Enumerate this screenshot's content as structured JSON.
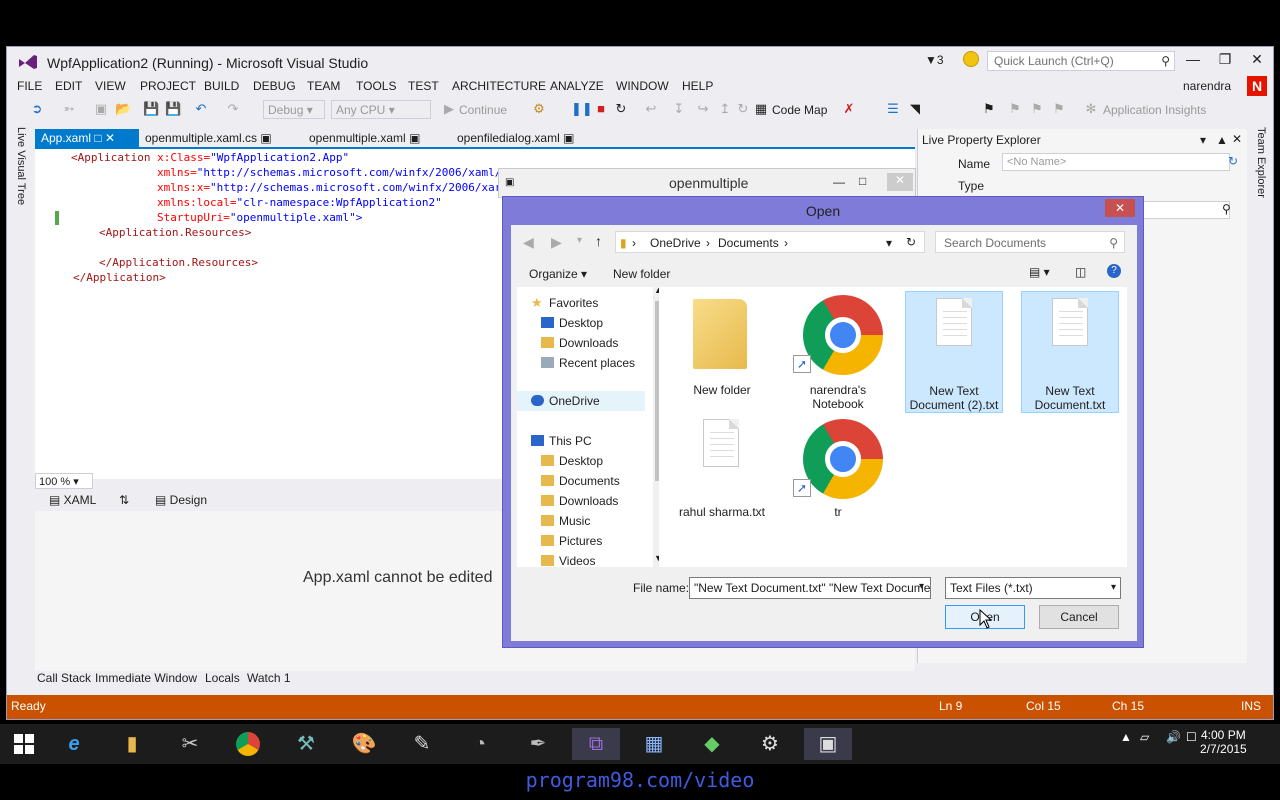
{
  "vs": {
    "title": "WpfApplication2 (Running) - Microsoft Visual Studio",
    "notification_count": "3",
    "quick_launch_placeholder": "Quick Launch (Ctrl+Q)",
    "user": "narendra",
    "user_badge": "N",
    "menu": [
      "FILE",
      "EDIT",
      "VIEW",
      "PROJECT",
      "BUILD",
      "DEBUG",
      "TEAM",
      "TOOLS",
      "TEST",
      "ARCHITECTURE",
      "ANALYZE",
      "WINDOW",
      "HELP"
    ],
    "toolbar": {
      "config": "Debug",
      "platform": "Any CPU",
      "continue": "Continue",
      "code_map": "Code Map",
      "app_insights": "Application Insights"
    },
    "left_vertical_tab": "Live Visual Tree",
    "right_vertical_tab": "Team Explorer"
  },
  "doc_tabs": [
    {
      "label": "App.xaml"
    },
    {
      "label": "openmultiple.xaml.cs"
    },
    {
      "label": "openmultiple.xaml"
    },
    {
      "label": "openfiledialog.xaml"
    }
  ],
  "code": {
    "l1_tag": "<Application",
    "l1_attr": " x:Class=",
    "l1_val": "\"WpfApplication2.App\"",
    "l2_attr": "xmlns=",
    "l2_val": "\"http://schemas.microsoft.com/winfx/2006/xaml/",
    "l3_attr": "xmlns:x=",
    "l3_val": "\"http://schemas.microsoft.com/winfx/2006/xar",
    "l4_attr": "xmlns:local=",
    "l4_val": "\"clr-namespace:WpfApplication2\"",
    "l5_attr": "StartupUri=",
    "l5_val": "\"openmultiple.xaml\"",
    "l5_end": ">",
    "l6": "<Application.Resources>",
    "l7": "</Application.Resources>",
    "l8": "</Application>"
  },
  "editor": {
    "zoom": "100 %",
    "xaml_tab": "XAML",
    "design_tab": "Design",
    "designer_message": "App.xaml cannot be edited"
  },
  "lpe": {
    "title": "Live Property Explorer",
    "name_label": "Name",
    "name_value": "<No Name>",
    "type_label": "Type"
  },
  "bottom_tabs": [
    "Call Stack",
    "Immediate Window",
    "Locals",
    "Watch 1"
  ],
  "status": {
    "ready": "Ready",
    "ln": "Ln 9",
    "col": "Col 15",
    "ch": "Ch 15",
    "ins": "INS"
  },
  "wpf_window": {
    "title": "openmultiple"
  },
  "dialog": {
    "title": "Open",
    "breadcrumb": [
      "OneDrive",
      "Documents"
    ],
    "search_placeholder": "Search Documents",
    "organize": "Organize",
    "new_folder": "New folder",
    "nav": [
      {
        "label": "Favorites",
        "icon": "star-icon"
      },
      {
        "label": "Desktop",
        "icon": "desktop-icon"
      },
      {
        "label": "Downloads",
        "icon": "folder-icon"
      },
      {
        "label": "Recent places",
        "icon": "recent-icon"
      },
      {
        "label": "OneDrive",
        "icon": "cloud-icon"
      },
      {
        "label": "This PC",
        "icon": "computer-icon"
      },
      {
        "label": "Desktop",
        "icon": "desktop-icon"
      },
      {
        "label": "Documents",
        "icon": "folder-icon"
      },
      {
        "label": "Downloads",
        "icon": "folder-icon"
      },
      {
        "label": "Music",
        "icon": "folder-icon"
      },
      {
        "label": "Pictures",
        "icon": "folder-icon"
      },
      {
        "label": "Videos",
        "icon": "folder-icon"
      }
    ],
    "files": [
      {
        "name": "New folder",
        "kind": "folder"
      },
      {
        "name": "narendra's Notebook",
        "kind": "chrome-shortcut"
      },
      {
        "name": "New Text Document (2).txt",
        "kind": "text",
        "selected": true
      },
      {
        "name": "New Text Document.txt",
        "kind": "text",
        "selected": true
      },
      {
        "name": "rahul sharma.txt",
        "kind": "text"
      },
      {
        "name": "tr",
        "kind": "chrome-shortcut"
      }
    ],
    "file_name_label": "File name:",
    "file_name_value": "\"New Text Document.txt\" \"New Text Docume",
    "file_type": "Text Files (*.txt)",
    "open": "Open",
    "cancel": "Cancel"
  },
  "taskbar": {
    "time": "4:00 PM",
    "date": "2/7/2015"
  },
  "caption": "program98.com/video"
}
